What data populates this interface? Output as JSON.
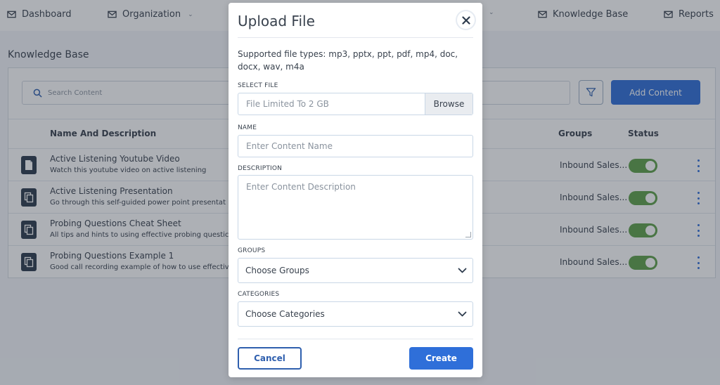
{
  "nav": {
    "items": [
      {
        "label": "Dashboard",
        "icon": "mail-icon"
      },
      {
        "label": "Organization",
        "icon": "mail-icon",
        "has_dropdown": true
      },
      {
        "label": "Knowledge Base",
        "icon": "mail-icon"
      },
      {
        "label": "Reports",
        "icon": "mail-icon"
      }
    ]
  },
  "page": {
    "title": "Knowledge Base",
    "search_placeholder": "Search Content",
    "add_button": "Add Content",
    "columns": {
      "name": "Name And Description",
      "groups": "Groups",
      "status": "Status"
    },
    "rows": [
      {
        "name": "Active Listening Youtube Video",
        "desc": "Watch this youtube video on active listening",
        "group": "Inbound Sales...",
        "icon": "file-icon",
        "enabled": true
      },
      {
        "name": "Active Listening Presentation",
        "desc": "Go through this self-guided power point presentat",
        "group": "Inbound Sales...",
        "icon": "copy-icon",
        "enabled": true
      },
      {
        "name": "Probing Questions Cheat Sheet",
        "desc": "All tips and hints to using effective probing questic",
        "group": "Inbound Sales...",
        "icon": "copy-icon",
        "enabled": true
      },
      {
        "name": "Probing Questions Example 1",
        "desc": "Good call recording example of how to use effective",
        "group": "Inbound Sales...",
        "icon": "copy-icon",
        "enabled": true
      }
    ]
  },
  "modal": {
    "title": "Upload File",
    "supported_types": "Supported file types: mp3, pptx, ppt, pdf, mp4, doc, docx, wav, m4a",
    "select_file": {
      "label": "SELECT FILE",
      "placeholder": "File Limited To 2 GB",
      "browse": "Browse"
    },
    "name": {
      "label": "NAME",
      "placeholder": "Enter Content Name"
    },
    "description": {
      "label": "DESCRIPTION",
      "placeholder": "Enter Content Description"
    },
    "groups": {
      "label": "GROUPS",
      "value": "Choose Groups"
    },
    "categories": {
      "label": "CATEGORIES",
      "value": "Choose Categories"
    },
    "cancel": "Cancel",
    "create": "Create"
  },
  "colors": {
    "primary": "#2f6fd9",
    "toggle_on": "#5ea04a",
    "text": "#39424e",
    "overlay": "rgba(40,48,60,0.38)"
  }
}
